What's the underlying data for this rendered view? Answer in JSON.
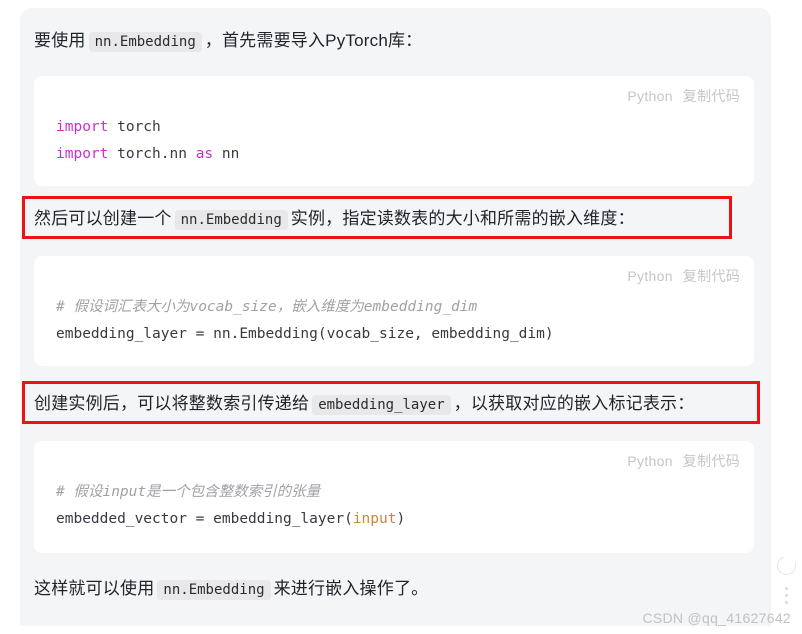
{
  "panel": {
    "watermark": "CSDN @qq_41627642"
  },
  "paragraphs": [
    {
      "id": "intro",
      "before": "要使用",
      "code": "nn.Embedding",
      "after": "，首先需要导入PyTorch库："
    },
    {
      "id": "create-instance",
      "before": "然后可以创建一个",
      "code": "nn.Embedding",
      "after": "实例，指定读数表的大小和所需的嵌入维度："
    },
    {
      "id": "pass-index",
      "before": "创建实例后，可以将整数索引传递给",
      "code": "embedding_layer",
      "after": "，以获取对应的嵌入标记表示："
    },
    {
      "id": "conclusion",
      "before": "这样就可以使用",
      "code": "nn.Embedding",
      "after": "来进行嵌入操作了。"
    }
  ],
  "code_blocks": [
    {
      "id": "block-1",
      "lang_label": "Python",
      "copy_label": "复制代码",
      "lines": [
        [
          {
            "t": "import",
            "c": "kw"
          },
          {
            "t": " torch",
            "c": ""
          }
        ],
        [
          {
            "t": "import",
            "c": "kw"
          },
          {
            "t": " torch.nn ",
            "c": ""
          },
          {
            "t": "as",
            "c": "kw"
          },
          {
            "t": " nn",
            "c": ""
          }
        ]
      ]
    },
    {
      "id": "block-2",
      "lang_label": "Python",
      "copy_label": "复制代码",
      "lines": [
        [
          {
            "t": "# 假设词汇表大小为vocab_size，嵌入维度为embedding_dim",
            "c": "cm"
          }
        ],
        [
          {
            "t": "embedding_layer = nn.Embedding(vocab_size, embedding_dim)",
            "c": ""
          }
        ]
      ]
    },
    {
      "id": "block-3",
      "lang_label": "Python",
      "copy_label": "复制代码",
      "lines": [
        [
          {
            "t": "# 假设input是一个包含整数索引的张量",
            "c": "cm"
          }
        ],
        [
          {
            "t": "embedded_vector = embedding_layer(",
            "c": ""
          },
          {
            "t": "input",
            "c": "bi"
          },
          {
            "t": ")",
            "c": ""
          }
        ]
      ]
    }
  ],
  "colors": {
    "page_background": "#ffffff",
    "panel_background": "#f3f5f7",
    "code_card_background": "#ffffff",
    "highlight_border": "#ee1111",
    "keyword": "#c932c9",
    "comment": "#a0a1a7",
    "builtin": "#c7883a",
    "text": "#1f2329",
    "muted": "#c3c6ca"
  },
  "icons": {
    "refresh": "refresh-ring-icon",
    "more": "more-vertical-icon"
  }
}
